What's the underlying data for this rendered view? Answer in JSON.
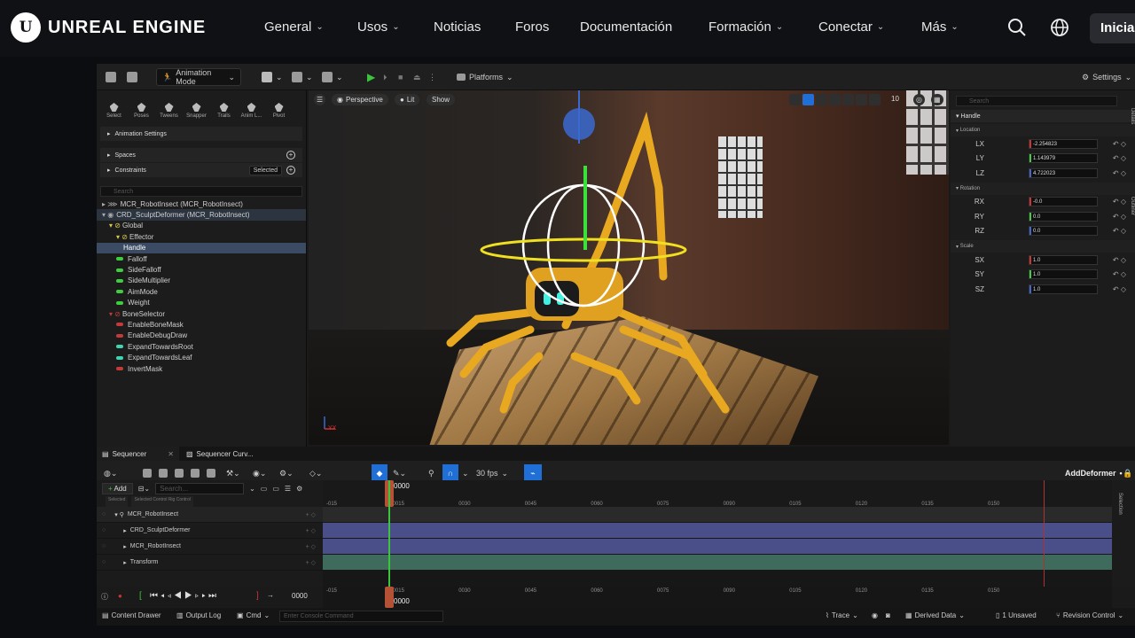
{
  "nav": {
    "logo_mark": "U",
    "logo_text": "UNREAL ENGINE",
    "items": [
      {
        "label": "General",
        "dropdown": true
      },
      {
        "label": "Usos",
        "dropdown": true
      },
      {
        "label": "Noticias",
        "dropdown": false
      },
      {
        "label": "Foros",
        "dropdown": false
      },
      {
        "label": "Documentación",
        "dropdown": false
      },
      {
        "label": "Formación",
        "dropdown": true
      },
      {
        "label": "Conectar",
        "dropdown": true
      },
      {
        "label": "Más",
        "dropdown": true
      }
    ],
    "start_label": "Inicia"
  },
  "toolbar": {
    "mode_label": "Animation Mode",
    "platforms_label": "Platforms",
    "settings_label": "Settings"
  },
  "anim_tools": [
    "Select",
    "Poses",
    "Tweens",
    "Snapper",
    "Trails",
    "Anim L...",
    "Pivot"
  ],
  "left_sections": {
    "animation_settings": "Animation Settings",
    "spaces": "Spaces",
    "constraints": "Constraints",
    "constraints_value": "Selected"
  },
  "rig_search_placeholder": "Search",
  "rig_tree": [
    {
      "label": "MCR_RobotInsect  (MCR_RobotInsect)",
      "indent": 0,
      "color": "#888",
      "kind": "root"
    },
    {
      "label": "CRD_SculptDeformer  (MCR_RobotInsect)",
      "indent": 0,
      "color": "#888",
      "kind": "root"
    },
    {
      "label": "Global",
      "indent": 1,
      "color": "#d8c84a",
      "kind": "control"
    },
    {
      "label": "Effector",
      "indent": 2,
      "color": "#d8c84a",
      "kind": "control"
    },
    {
      "label": "Handle",
      "indent": 3,
      "color": "#5a8ee0",
      "kind": "selected"
    },
    {
      "label": "Falloff",
      "indent": 2,
      "color": "#3ecf3e",
      "kind": "pill"
    },
    {
      "label": "SideFalloff",
      "indent": 2,
      "color": "#3ecf3e",
      "kind": "pill"
    },
    {
      "label": "SideMultiplier",
      "indent": 2,
      "color": "#3ecf3e",
      "kind": "pill"
    },
    {
      "label": "AimMode",
      "indent": 2,
      "color": "#3ecf3e",
      "kind": "pill"
    },
    {
      "label": "Weight",
      "indent": 2,
      "color": "#3ecf3e",
      "kind": "pill"
    },
    {
      "label": "BoneSelector",
      "indent": 1,
      "color": "#c43a3a",
      "kind": "control"
    },
    {
      "label": "EnableBoneMask",
      "indent": 2,
      "color": "#c43a3a",
      "kind": "pill"
    },
    {
      "label": "EnableDebugDraw",
      "indent": 2,
      "color": "#c43a3a",
      "kind": "pill"
    },
    {
      "label": "ExpandTowardsRoot",
      "indent": 2,
      "color": "#3ed6b0",
      "kind": "pill"
    },
    {
      "label": "ExpandTowardsLeaf",
      "indent": 2,
      "color": "#3ed6b0",
      "kind": "pill"
    },
    {
      "label": "InvertMask",
      "indent": 2,
      "color": "#c43a3a",
      "kind": "pill"
    }
  ],
  "viewport": {
    "perspective": "Perspective",
    "lit": "Lit",
    "show": "Show",
    "grid_value": "10",
    "axis_label": "YX"
  },
  "details": {
    "search_placeholder": "Search",
    "section": "Handle",
    "location_label": "Location",
    "rotation_label": "Rotation",
    "scale_label": "Scale",
    "location": [
      {
        "label": "LX",
        "value": "-2.254823",
        "axis": "r"
      },
      {
        "label": "LY",
        "value": "1.143979",
        "axis": "g"
      },
      {
        "label": "LZ",
        "value": "4.722023",
        "axis": "b"
      }
    ],
    "rotation": [
      {
        "label": "RX",
        "value": "-0.0",
        "axis": "r"
      },
      {
        "label": "RY",
        "value": "0.0",
        "axis": "g"
      },
      {
        "label": "RZ",
        "value": "0.0",
        "axis": "b"
      }
    ],
    "scale": [
      {
        "label": "SX",
        "value": "1.0",
        "axis": "r"
      },
      {
        "label": "SY",
        "value": "1.0",
        "axis": "g"
      },
      {
        "label": "SZ",
        "value": "1.0",
        "axis": "b"
      }
    ],
    "side_tab_details": "Details",
    "side_tab_outliner": "Outliner"
  },
  "sequencer": {
    "tabs": [
      "Sequencer",
      "Sequencer Curv..."
    ],
    "fps": "30 fps",
    "sequence_name": "AddDeformer",
    "add_label": "Add",
    "search_placeholder": "Search...",
    "filter_chips": [
      "Selected",
      "Selected Control Rig Control"
    ],
    "tracks": [
      {
        "label": "MCR_RobotInsect",
        "indent": 0
      },
      {
        "label": "CRD_SculptDeformer",
        "indent": 1
      },
      {
        "label": "MCR_RobotInsect",
        "indent": 1
      },
      {
        "label": "Transform",
        "indent": 1
      }
    ],
    "current_frame": "0000",
    "ticks": [
      "-015",
      "0015",
      "0030",
      "0045",
      "0060",
      "0075",
      "0090",
      "0105",
      "0120",
      "0135",
      "0150"
    ],
    "selection_tab": "Selection"
  },
  "status": {
    "content_drawer": "Content Drawer",
    "output_log": "Output Log",
    "cmd": "Cmd",
    "console_placeholder": "Enter Console Command",
    "trace": "Trace",
    "derived_data": "Derived Data",
    "unsaved": "1 Unsaved",
    "revision_control": "Revision Control"
  }
}
